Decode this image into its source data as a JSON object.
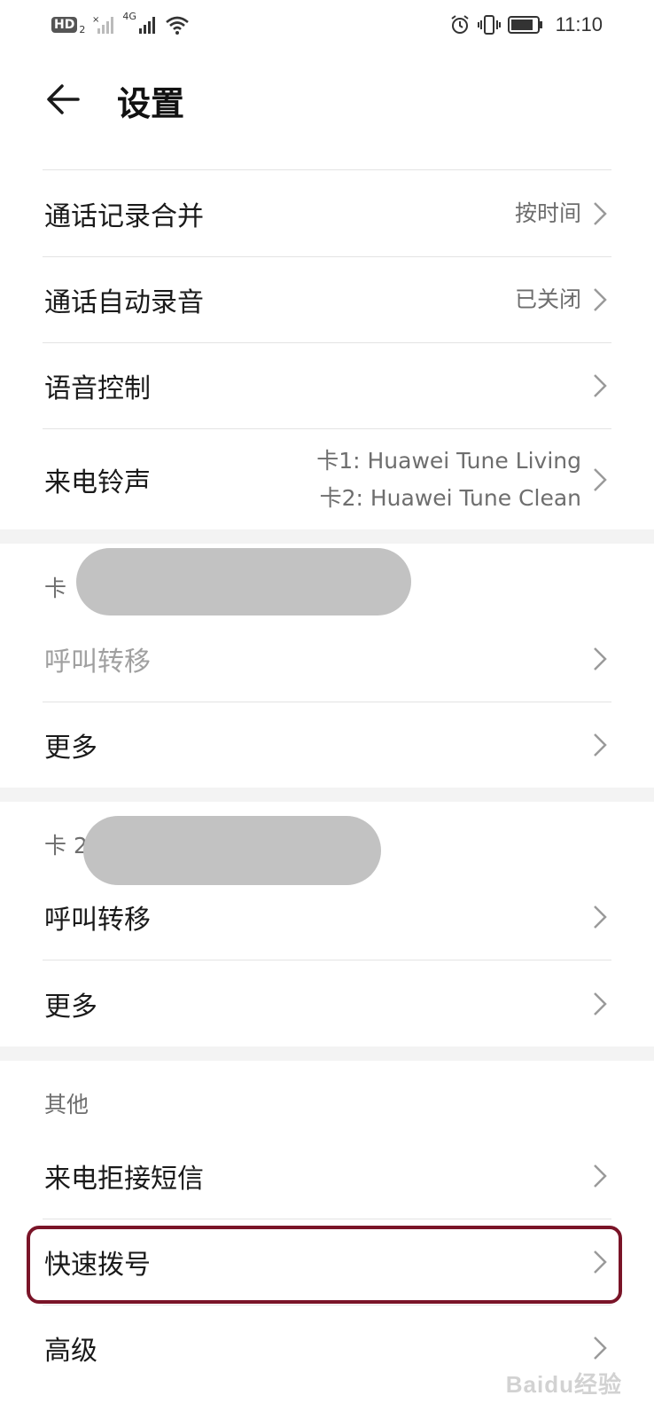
{
  "status_bar": {
    "hd_label": "HD",
    "hd_sub": "2",
    "network_label": "4G",
    "time": "11:10"
  },
  "header": {
    "title": "设置"
  },
  "general": {
    "items": [
      {
        "label": "通话记录合并",
        "value": "按时间"
      },
      {
        "label": "通话自动录音",
        "value": "已关闭"
      },
      {
        "label": "语音控制",
        "value": ""
      },
      {
        "label": "来电铃声",
        "value_line1": "卡1: Huawei Tune Living",
        "value_line2": "卡2: Huawei Tune Clean"
      }
    ]
  },
  "card1": {
    "title": "卡",
    "items": [
      {
        "label": "呼叫转移"
      },
      {
        "label": "更多"
      }
    ]
  },
  "card2": {
    "title": "卡 2",
    "items": [
      {
        "label": "呼叫转移"
      },
      {
        "label": "更多"
      }
    ]
  },
  "other": {
    "title": "其他",
    "items": [
      {
        "label": "来电拒接短信"
      },
      {
        "label": "快速拨号"
      },
      {
        "label": "高级"
      }
    ]
  },
  "watermark": "Baidu经验",
  "colors": {
    "highlight": "#7a1428",
    "text_primary": "#1a1a1a",
    "text_secondary": "#6e6e6e",
    "disabled": "#a0a0a0"
  }
}
